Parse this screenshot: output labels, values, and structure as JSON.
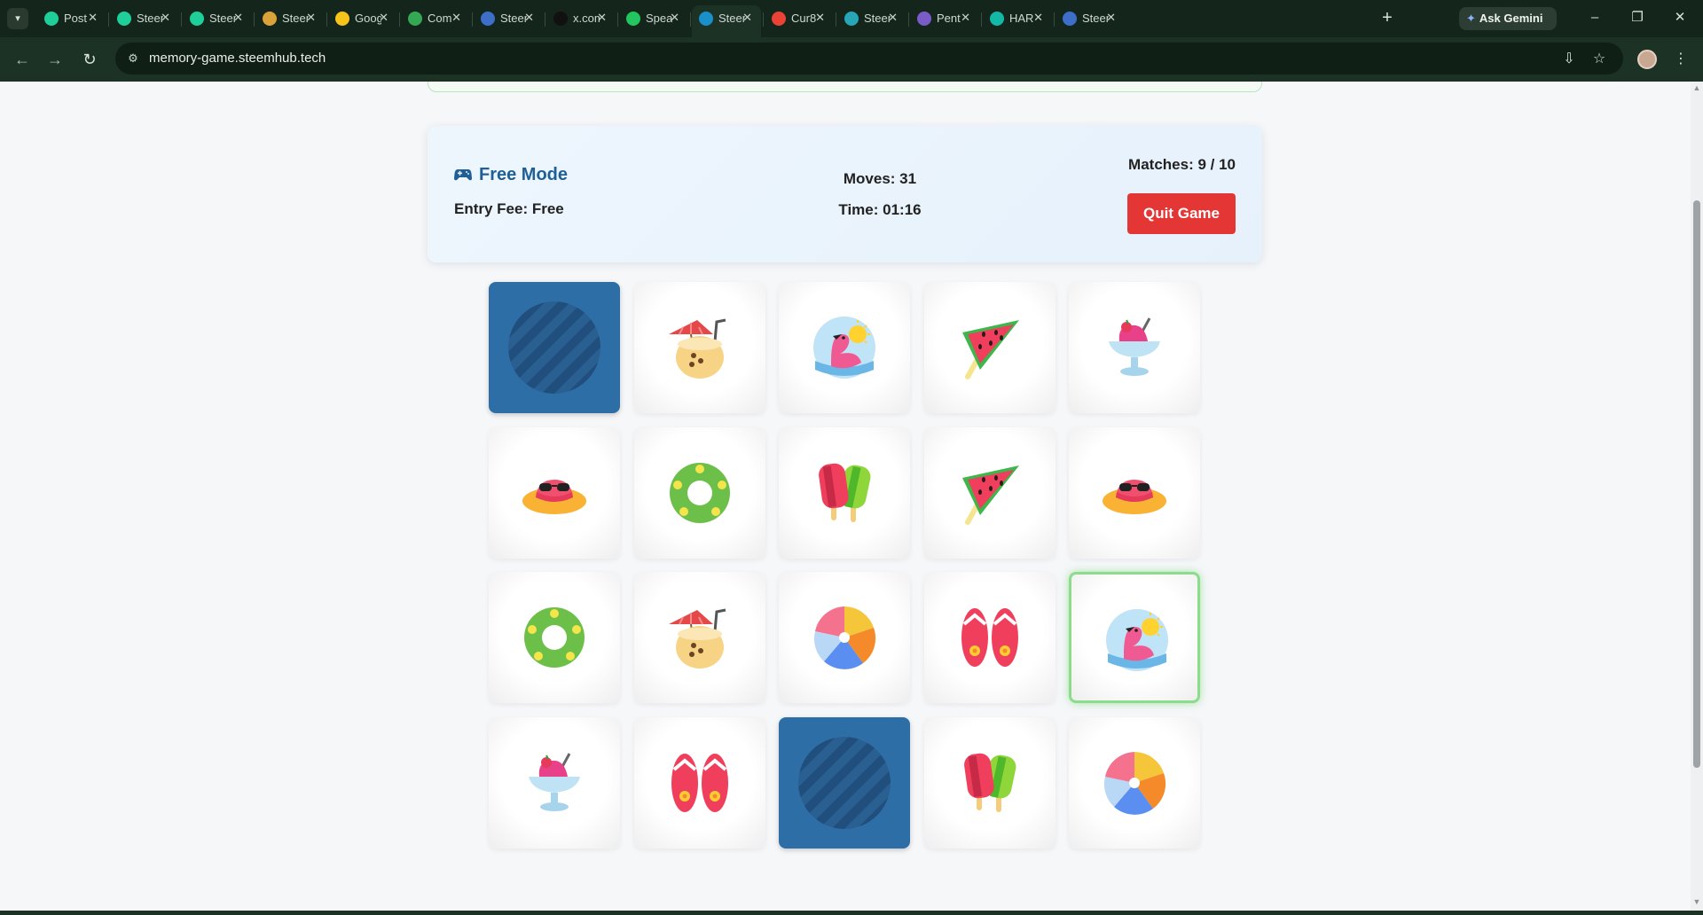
{
  "browser": {
    "tabs": [
      {
        "title": "Post",
        "favicon_color": "#1fcf9a"
      },
      {
        "title": "Steem",
        "favicon_color": "#1fcf9a"
      },
      {
        "title": "Steem",
        "favicon_color": "#1fcf9a"
      },
      {
        "title": "Steem",
        "favicon_color": "#d9a33a"
      },
      {
        "title": "Google",
        "favicon_color": "#f6c31b"
      },
      {
        "title": "Com",
        "favicon_color": "#34a853"
      },
      {
        "title": "Steem",
        "favicon_color": "#3d6fc9"
      },
      {
        "title": "x.com",
        "favicon_color": "#111111"
      },
      {
        "title": "Speak",
        "favicon_color": "#22c55e"
      },
      {
        "title": "Steem",
        "favicon_color": "#1a8fc9"
      },
      {
        "title": "Cur8",
        "favicon_color": "#ea4335"
      },
      {
        "title": "Steem",
        "favicon_color": "#27a6b8"
      },
      {
        "title": "Pent",
        "favicon_color": "#7a5cc9"
      },
      {
        "title": "HAR",
        "favicon_color": "#14b8a6"
      },
      {
        "title": "Steem",
        "favicon_color": "#3d6fc9"
      }
    ],
    "active_tab_index": 9,
    "ask_gemini_label": "Ask Gemini",
    "url": "memory-game.steemhub.tech"
  },
  "game": {
    "mode": "Free Mode",
    "entry_fee": "Entry Fee: Free",
    "moves": "Moves: 31",
    "time": "Time: 01:16",
    "matches": "Matches: 9 / 10",
    "quit_label": "Quit Game"
  },
  "board": {
    "rows": 4,
    "cols": 5,
    "cards": [
      {
        "icon": "card-back-icon",
        "state": "face-down"
      },
      {
        "icon": "coconut-drink-icon",
        "state": "matched"
      },
      {
        "icon": "flamingo-float-icon",
        "state": "matched"
      },
      {
        "icon": "watermelon-slice-icon",
        "state": "matched"
      },
      {
        "icon": "shaved-ice-icon",
        "state": "matched"
      },
      {
        "icon": "sun-hat-icon",
        "state": "matched"
      },
      {
        "icon": "swim-ring-icon",
        "state": "matched"
      },
      {
        "icon": "popsicles-icon",
        "state": "matched"
      },
      {
        "icon": "watermelon-slice-icon",
        "state": "matched"
      },
      {
        "icon": "sun-hat-icon",
        "state": "matched"
      },
      {
        "icon": "swim-ring-icon",
        "state": "matched"
      },
      {
        "icon": "coconut-drink-icon",
        "state": "matched"
      },
      {
        "icon": "beach-ball-icon",
        "state": "matched"
      },
      {
        "icon": "flip-flops-icon",
        "state": "matched"
      },
      {
        "icon": "flamingo-float-icon",
        "state": "selected"
      },
      {
        "icon": "shaved-ice-icon",
        "state": "matched"
      },
      {
        "icon": "flip-flops-icon",
        "state": "matched"
      },
      {
        "icon": "card-back-icon",
        "state": "face-down"
      },
      {
        "icon": "popsicles-icon",
        "state": "matched"
      },
      {
        "icon": "beach-ball-icon",
        "state": "matched"
      }
    ]
  },
  "colors": {
    "accent_blue": "#1f5f96",
    "card_back": "#2e6ea7",
    "quit_red": "#e53636",
    "selected_glow": "#8bdd8b"
  }
}
